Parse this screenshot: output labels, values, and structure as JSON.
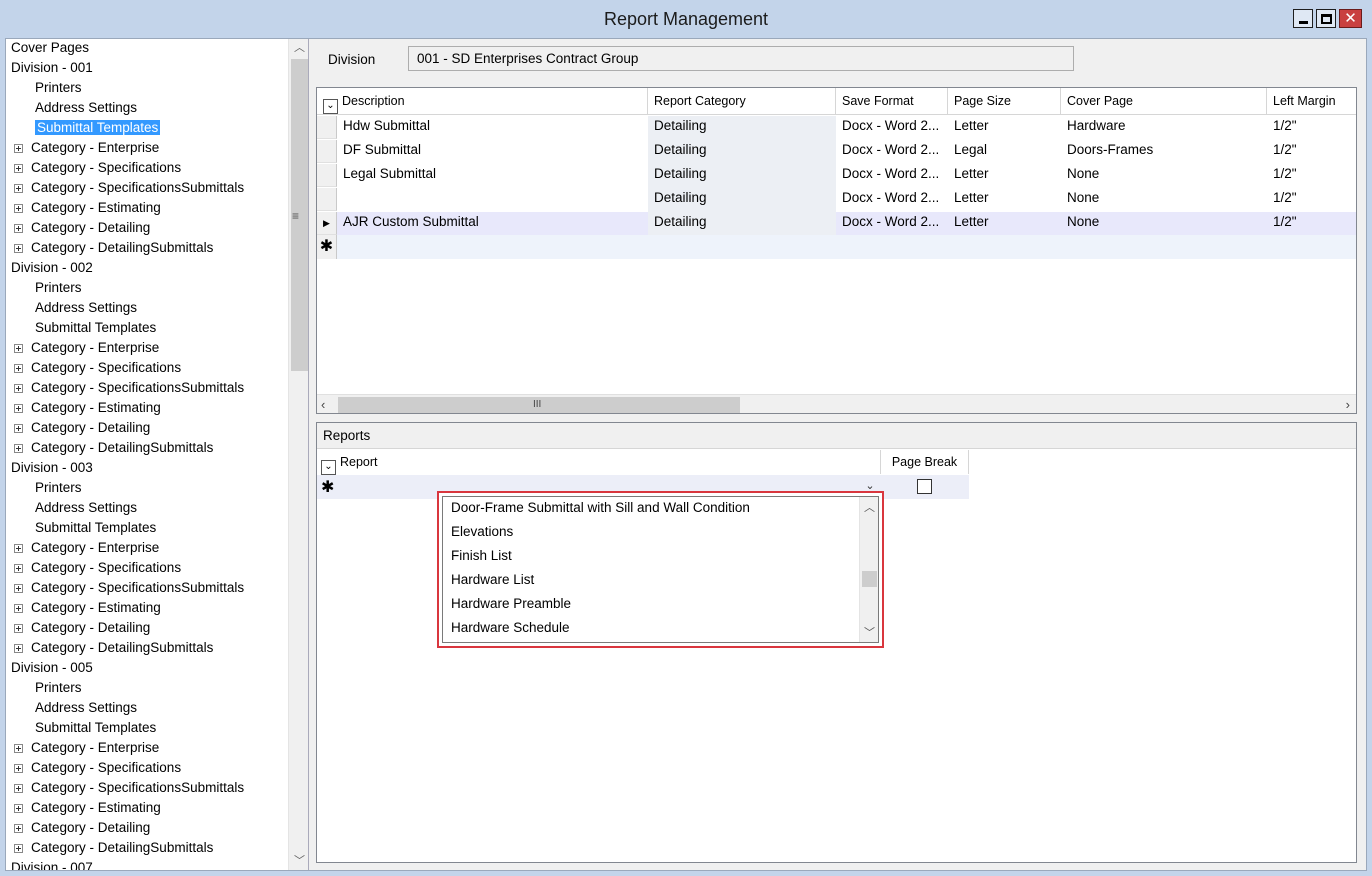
{
  "window": {
    "title": "Report Management"
  },
  "tree": {
    "items": [
      {
        "label": "Cover Pages",
        "level": 0,
        "expandable": false,
        "selected": false
      },
      {
        "label": "Division - 001",
        "level": 0,
        "expandable": false,
        "selected": false
      },
      {
        "label": "Printers",
        "level": 1,
        "expandable": false,
        "selected": false
      },
      {
        "label": "Address Settings",
        "level": 1,
        "expandable": false,
        "selected": false
      },
      {
        "label": "Submittal Templates",
        "level": 1,
        "expandable": false,
        "selected": true
      },
      {
        "label": "Category - Enterprise",
        "level": 1,
        "expandable": true,
        "selected": false
      },
      {
        "label": "Category - Specifications",
        "level": 1,
        "expandable": true,
        "selected": false
      },
      {
        "label": "Category - SpecificationsSubmittals",
        "level": 1,
        "expandable": true,
        "selected": false
      },
      {
        "label": "Category - Estimating",
        "level": 1,
        "expandable": true,
        "selected": false
      },
      {
        "label": "Category - Detailing",
        "level": 1,
        "expandable": true,
        "selected": false
      },
      {
        "label": "Category - DetailingSubmittals",
        "level": 1,
        "expandable": true,
        "selected": false
      },
      {
        "label": "Division - 002",
        "level": 0,
        "expandable": false,
        "selected": false
      },
      {
        "label": "Printers",
        "level": 1,
        "expandable": false,
        "selected": false
      },
      {
        "label": "Address Settings",
        "level": 1,
        "expandable": false,
        "selected": false
      },
      {
        "label": "Submittal Templates",
        "level": 1,
        "expandable": false,
        "selected": false
      },
      {
        "label": "Category - Enterprise",
        "level": 1,
        "expandable": true,
        "selected": false
      },
      {
        "label": "Category - Specifications",
        "level": 1,
        "expandable": true,
        "selected": false
      },
      {
        "label": "Category - SpecificationsSubmittals",
        "level": 1,
        "expandable": true,
        "selected": false
      },
      {
        "label": "Category - Estimating",
        "level": 1,
        "expandable": true,
        "selected": false
      },
      {
        "label": "Category - Detailing",
        "level": 1,
        "expandable": true,
        "selected": false
      },
      {
        "label": "Category - DetailingSubmittals",
        "level": 1,
        "expandable": true,
        "selected": false
      },
      {
        "label": "Division - 003",
        "level": 0,
        "expandable": false,
        "selected": false
      },
      {
        "label": "Printers",
        "level": 1,
        "expandable": false,
        "selected": false
      },
      {
        "label": "Address Settings",
        "level": 1,
        "expandable": false,
        "selected": false
      },
      {
        "label": "Submittal Templates",
        "level": 1,
        "expandable": false,
        "selected": false
      },
      {
        "label": "Category - Enterprise",
        "level": 1,
        "expandable": true,
        "selected": false
      },
      {
        "label": "Category - Specifications",
        "level": 1,
        "expandable": true,
        "selected": false
      },
      {
        "label": "Category - SpecificationsSubmittals",
        "level": 1,
        "expandable": true,
        "selected": false
      },
      {
        "label": "Category - Estimating",
        "level": 1,
        "expandable": true,
        "selected": false
      },
      {
        "label": "Category - Detailing",
        "level": 1,
        "expandable": true,
        "selected": false
      },
      {
        "label": "Category - DetailingSubmittals",
        "level": 1,
        "expandable": true,
        "selected": false
      },
      {
        "label": "Division - 005",
        "level": 0,
        "expandable": false,
        "selected": false
      },
      {
        "label": "Printers",
        "level": 1,
        "expandable": false,
        "selected": false
      },
      {
        "label": "Address Settings",
        "level": 1,
        "expandable": false,
        "selected": false
      },
      {
        "label": "Submittal Templates",
        "level": 1,
        "expandable": false,
        "selected": false
      },
      {
        "label": "Category - Enterprise",
        "level": 1,
        "expandable": true,
        "selected": false
      },
      {
        "label": "Category - Specifications",
        "level": 1,
        "expandable": true,
        "selected": false
      },
      {
        "label": "Category - SpecificationsSubmittals",
        "level": 1,
        "expandable": true,
        "selected": false
      },
      {
        "label": "Category - Estimating",
        "level": 1,
        "expandable": true,
        "selected": false
      },
      {
        "label": "Category - Detailing",
        "level": 1,
        "expandable": true,
        "selected": false
      },
      {
        "label": "Category - DetailingSubmittals",
        "level": 1,
        "expandable": true,
        "selected": false
      },
      {
        "label": "Division - 007",
        "level": 0,
        "expandable": false,
        "selected": false
      }
    ]
  },
  "division": {
    "label": "Division",
    "value": "001 - SD Enterprises Contract Group"
  },
  "templates_grid": {
    "columns": [
      "Description",
      "Report Category",
      "Save Format",
      "Page Size",
      "Cover Page",
      "Left Margin"
    ],
    "rows": [
      {
        "description": "Hdw Submittal",
        "category": "Detailing",
        "save_format": "Docx - Word 2...",
        "page_size": "Letter",
        "cover_page": "Hardware",
        "left_margin": "1/2\"",
        "current": false
      },
      {
        "description": "DF Submittal",
        "category": "Detailing",
        "save_format": "Docx - Word 2...",
        "page_size": "Legal",
        "cover_page": "Doors-Frames",
        "left_margin": "1/2\"",
        "current": false
      },
      {
        "description": "Legal Submittal",
        "category": "Detailing",
        "save_format": "Docx - Word 2...",
        "page_size": "Letter",
        "cover_page": "None",
        "left_margin": "1/2\"",
        "current": false
      },
      {
        "description": "",
        "category": "Detailing",
        "save_format": "Docx - Word 2...",
        "page_size": "Letter",
        "cover_page": "None",
        "left_margin": "1/2\"",
        "current": false
      },
      {
        "description": "AJR Custom Submittal",
        "category": "Detailing",
        "save_format": "Docx - Word 2...",
        "page_size": "Letter",
        "cover_page": "None",
        "left_margin": "1/2\"",
        "current": true
      }
    ],
    "new_row_marker": "✱",
    "current_row_marker": "▶",
    "hscroll_grip": "III"
  },
  "reports_panel": {
    "title": "Reports",
    "columns": [
      "Report",
      "Page Break"
    ],
    "new_row_marker": "✱",
    "page_break_checked": false,
    "dropdown_options": [
      "Door-Frame Submittal with Sill and Wall Condition",
      "Elevations",
      "Finish List",
      "Hardware List",
      "Hardware Preamble",
      "Hardware Schedule"
    ]
  },
  "colors": {
    "title_bar": "#c3d4ea",
    "selection": "#3399ff",
    "highlight_border": "#d9363e",
    "close_button": "#c94040"
  }
}
